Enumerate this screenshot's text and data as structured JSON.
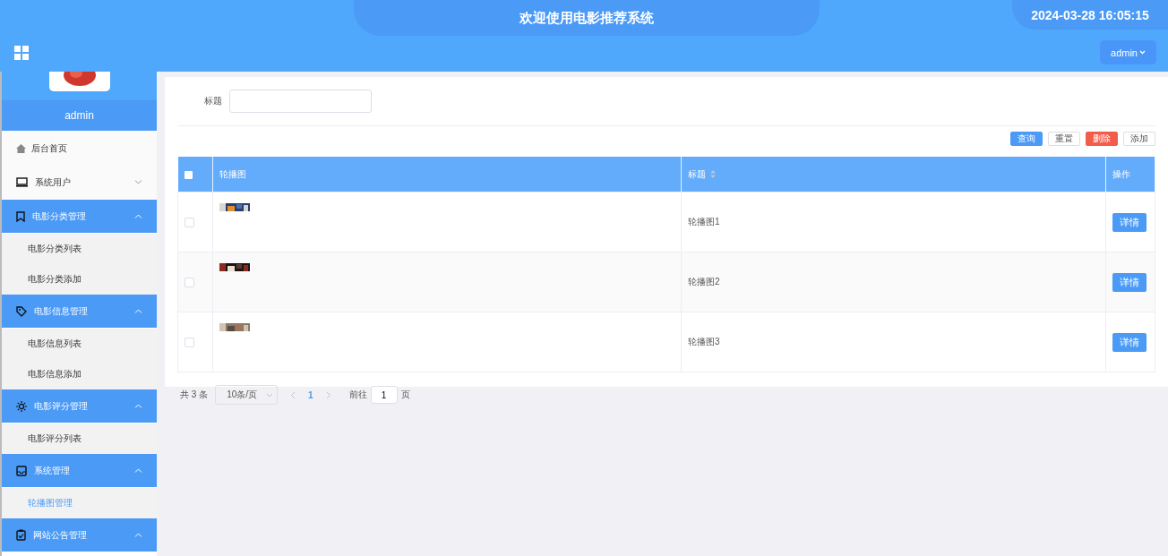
{
  "header": {
    "title": "欢迎使用电影推荐系统",
    "datetime": "2024-03-28 16:05:15",
    "user_menu": "admin"
  },
  "sidebar": {
    "username": "admin",
    "items": [
      {
        "label": "后台首页",
        "kind": "link"
      },
      {
        "label": "系统用户",
        "kind": "group",
        "expanded": false
      },
      {
        "label": "电影分类管理",
        "kind": "group",
        "expanded": true,
        "children": [
          {
            "label": "电影分类列表",
            "selected": false
          },
          {
            "label": "电影分类添加",
            "selected": false
          }
        ]
      },
      {
        "label": "电影信息管理",
        "kind": "group",
        "expanded": true,
        "children": [
          {
            "label": "电影信息列表",
            "selected": false
          },
          {
            "label": "电影信息添加",
            "selected": false
          }
        ]
      },
      {
        "label": "电影评分管理",
        "kind": "group",
        "expanded": true,
        "children": [
          {
            "label": "电影评分列表",
            "selected": false
          }
        ]
      },
      {
        "label": "系统管理",
        "kind": "group",
        "expanded": true,
        "children": [
          {
            "label": "轮播图管理",
            "selected": true
          }
        ]
      },
      {
        "label": "网站公告管理",
        "kind": "group",
        "expanded": true
      }
    ]
  },
  "search": {
    "label": "标题"
  },
  "buttons": [
    {
      "label": "查询",
      "kind": "primary"
    },
    {
      "label": "重置",
      "kind": "default"
    },
    {
      "label": "删除",
      "kind": "danger"
    },
    {
      "label": "添加",
      "kind": "default"
    }
  ],
  "table": {
    "header_checked": false,
    "columns": [
      {
        "label": "轮播图"
      },
      {
        "label": "标题",
        "sortable": true
      },
      {
        "label": "操作"
      }
    ],
    "rows": [
      {
        "checked": false,
        "title": "轮播图1",
        "action": "详情"
      },
      {
        "checked": false,
        "title": "轮播图2",
        "action": "详情"
      },
      {
        "checked": false,
        "title": "轮播图3",
        "action": "详情"
      }
    ]
  },
  "pagination": {
    "total": "共 3 条",
    "page_size": "10条/页",
    "pages": [
      {
        "label": "1",
        "selected": true
      }
    ],
    "goto_label": "前往",
    "goto_value": "1",
    "goto_suffix": "页"
  }
}
